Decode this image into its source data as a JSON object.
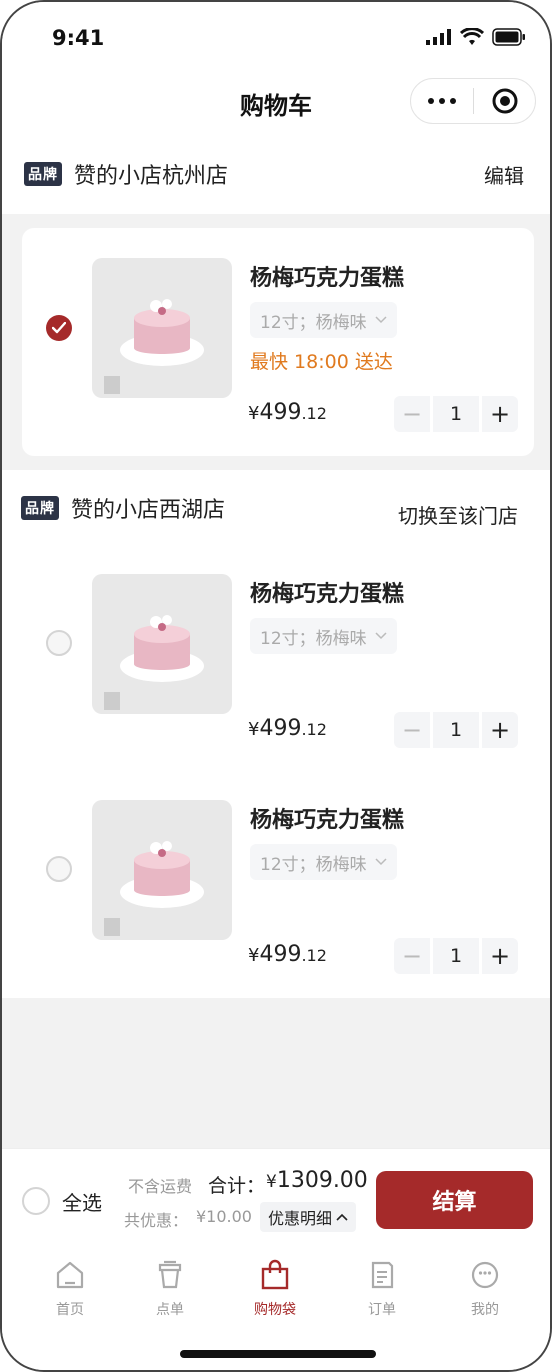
{
  "status_bar": {
    "time": "9:41"
  },
  "nav": {
    "title": "购物车"
  },
  "stores": [
    {
      "brand_tag": "品牌",
      "name": "赞的小店杭州店",
      "action": "编辑",
      "items": [
        {
          "name": "杨梅巧克力蛋糕",
          "spec": "12寸；杨梅味",
          "eta": "最快 18:00 送达",
          "price_currency": "¥",
          "price_int": "499",
          "price_dec": ".12",
          "quantity": "1",
          "selected": true
        }
      ]
    },
    {
      "brand_tag": "品牌",
      "name": "赞的小店西湖店",
      "action": "切换至该门店",
      "items": [
        {
          "name": "杨梅巧克力蛋糕",
          "spec": "12寸；杨梅味",
          "price_currency": "¥",
          "price_int": "499",
          "price_dec": ".12",
          "quantity": "1",
          "selected": false
        },
        {
          "name": "杨梅巧克力蛋糕",
          "spec": "12寸；杨梅味",
          "price_currency": "¥",
          "price_int": "499",
          "price_dec": ".12",
          "quantity": "1",
          "selected": false
        }
      ]
    }
  ],
  "summary": {
    "select_all": "全选",
    "shipping_note": "不含运费",
    "total_label": "合计：",
    "total_currency": "¥",
    "total_value": "1309.00",
    "discount_label": "共优惠：",
    "discount_value": "¥10.00",
    "discount_detail": "优惠明细",
    "checkout": "结算"
  },
  "tabbar": [
    {
      "label": "首页",
      "icon": "home-icon",
      "active": false
    },
    {
      "label": "点单",
      "icon": "cup-icon",
      "active": false
    },
    {
      "label": "购物袋",
      "icon": "bag-icon",
      "active": true
    },
    {
      "label": "订单",
      "icon": "order-icon",
      "active": false
    },
    {
      "label": "我的",
      "icon": "profile-icon",
      "active": false
    }
  ],
  "colors": {
    "accent": "#a52a2a",
    "eta": "#e07a1f",
    "brand_tag_bg": "#2c3346"
  }
}
